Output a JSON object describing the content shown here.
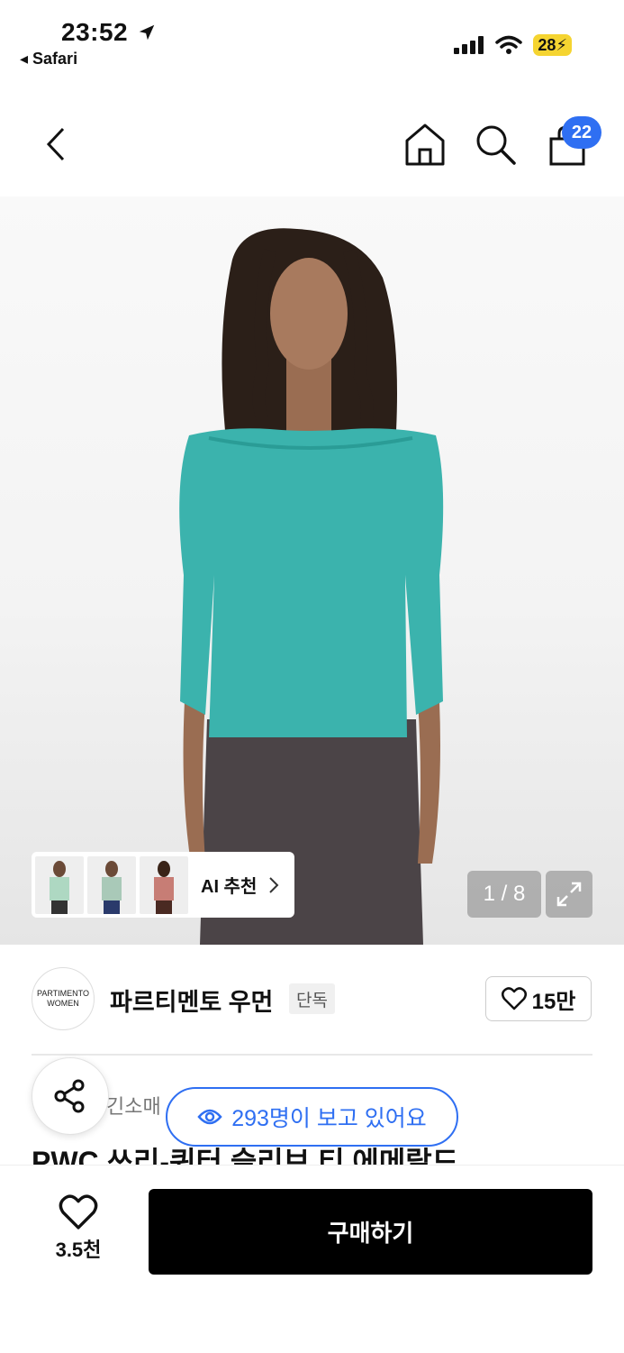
{
  "status_bar": {
    "time": "23:52",
    "back_app": "◂ Safari",
    "battery": "28"
  },
  "nav": {
    "cart_count": "22"
  },
  "hero": {
    "ai_recommend_label": "AI 추천",
    "page_indicator": "1 / 8",
    "model_sweater_color": "#3bb3ad"
  },
  "brand": {
    "logo_line1": "PARTIMENTO",
    "logo_line2": "WOMEN",
    "name": "파르티멘토 우먼",
    "exclusive_badge": "단독",
    "likes": "15만"
  },
  "product": {
    "category": "긴소매",
    "viewers_text": "293명이 보고 있어요",
    "title": "PWC 쓰리-쿼터 슬리브 티 에메랄드"
  },
  "bottom": {
    "wish_count": "3.5천",
    "buy_label": "구매하기"
  },
  "colors": {
    "accent": "#2f6ff2",
    "battery": "#f5d431",
    "buy_button": "#000000"
  }
}
